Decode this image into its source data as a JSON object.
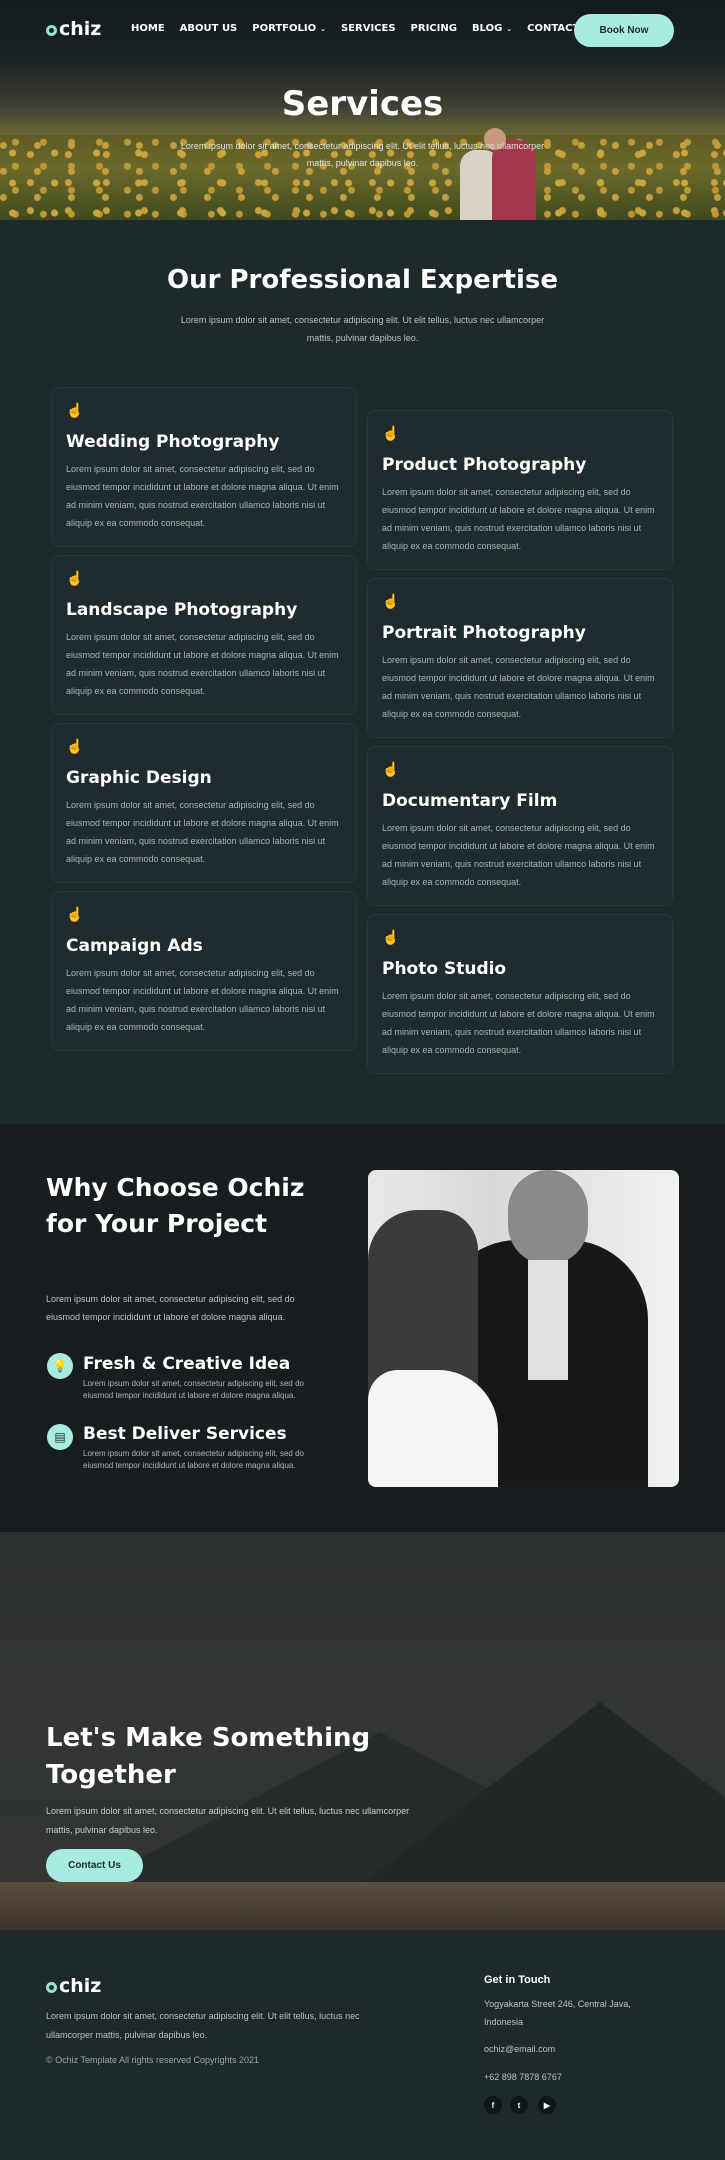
{
  "brand": {
    "name": "chiz",
    "accent": "#a8ebe0"
  },
  "nav": {
    "items": [
      {
        "label": "HOME",
        "dropdown": false
      },
      {
        "label": "ABOUT US",
        "dropdown": false
      },
      {
        "label": "PORTFOLIO",
        "dropdown": true
      },
      {
        "label": "SERVICES",
        "dropdown": false
      },
      {
        "label": "PRICING",
        "dropdown": false
      },
      {
        "label": "BLOG",
        "dropdown": true
      },
      {
        "label": "CONTACT US",
        "dropdown": false
      }
    ],
    "caret": "⌄",
    "book_label": "Book Now"
  },
  "hero": {
    "title": "Services",
    "subtitle": "Lorem ipsum dolor sit amet, consectetur adipiscing elit. Ut elit tellus, luctus nec ullamcorper mattis, pulvinar dapibus leo."
  },
  "expertise": {
    "title": "Our Professional Expertise",
    "subtitle": "Lorem ipsum dolor sit amet, consectetur adipiscing elit. Ut elit tellus, luctus nec ullamcorper mattis, pulvinar dapibus leo.",
    "icon": "☝",
    "cards": [
      {
        "title": "Wedding Photography",
        "text": "Lorem ipsum dolor sit amet, consectetur adipiscing elit, sed do eiusmod tempor incididunt ut labore et dolore magna aliqua. Ut enim ad minim veniam, quis nostrud exercitation ullamco laboris nisi ut aliquip ex ea commodo consequat."
      },
      {
        "title": "Product Photography",
        "text": "Lorem ipsum dolor sit amet, consectetur adipiscing elit, sed do eiusmod tempor incididunt ut labore et dolore magna aliqua. Ut enim ad minim veniam, quis nostrud exercitation ullamco laboris nisi ut aliquip ex ea commodo consequat."
      },
      {
        "title": "Landscape Photography",
        "text": "Lorem ipsum dolor sit amet, consectetur adipiscing elit, sed do eiusmod tempor incididunt ut labore et dolore magna aliqua. Ut enim ad minim veniam, quis nostrud exercitation ullamco laboris nisi ut aliquip ex ea commodo consequat."
      },
      {
        "title": "Portrait Photography",
        "text": "Lorem ipsum dolor sit amet, consectetur adipiscing elit, sed do eiusmod tempor incididunt ut labore et dolore magna aliqua. Ut enim ad minim veniam, quis nostrud exercitation ullamco laboris nisi ut aliquip ex ea commodo consequat."
      },
      {
        "title": "Graphic Design",
        "text": "Lorem ipsum dolor sit amet, consectetur adipiscing elit, sed do eiusmod tempor incididunt ut labore et dolore magna aliqua. Ut enim ad minim veniam, quis nostrud exercitation ullamco laboris nisi ut aliquip ex ea commodo consequat."
      },
      {
        "title": "Documentary Film",
        "text": "Lorem ipsum dolor sit amet, consectetur adipiscing elit, sed do eiusmod tempor incididunt ut labore et dolore magna aliqua. Ut enim ad minim veniam, quis nostrud exercitation ullamco laboris nisi ut aliquip ex ea commodo consequat."
      },
      {
        "title": "Campaign Ads",
        "text": "Lorem ipsum dolor sit amet, consectetur adipiscing elit, sed do eiusmod tempor incididunt ut labore et dolore magna aliqua. Ut enim ad minim veniam, quis nostrud exercitation ullamco laboris nisi ut aliquip ex ea commodo consequat."
      },
      {
        "title": "Photo Studio",
        "text": "Lorem ipsum dolor sit amet, consectetur adipiscing elit, sed do eiusmod tempor incididunt ut labore et dolore magna aliqua. Ut enim ad minim veniam, quis nostrud exercitation ullamco laboris nisi ut aliquip ex ea commodo consequat."
      }
    ]
  },
  "why": {
    "title": "Why Choose Ochiz for Your Project",
    "subtitle": "Lorem ipsum dolor sit amet, consectetur adipiscing elit, sed do eiusmod tempor incididunt ut labore et dolore magna aliqua.",
    "features": [
      {
        "icon": "💡",
        "icon_name": "lightbulb-icon",
        "title": "Fresh & Creative Idea",
        "text": "Lorem ipsum dolor sit amet, consectetur adipiscing elit, sed do eiusmod tempor incididunt ut labore et dolore magna aliqua."
      },
      {
        "icon": "▤",
        "icon_name": "card-icon",
        "title": "Best Deliver Services",
        "text": "Lorem ipsum dolor sit amet, consectetur adipiscing elit, sed do eiusmod tempor incididunt ut labore et dolore magna aliqua."
      }
    ]
  },
  "cta": {
    "title": "Let's Make Something Together",
    "subtitle": "Lorem ipsum dolor sit amet, consectetur adipiscing elit. Ut elit tellus, luctus nec ullamcorper mattis, pulvinar dapibus leo.",
    "button_label": "Contact Us"
  },
  "footer": {
    "description": "Lorem ipsum dolor sit amet, consectetur adipiscing elit. Ut elit tellus, luctus nec ullamcorper mattis, pulvinar dapibus leo.",
    "copyright": "© Ochiz Template All rights reserved Copyrights 2021",
    "contact_heading": "Get in Touch",
    "address": "Yogyakarta Street 246, Central Java, Indonesia",
    "email": "ochiz@email.com",
    "phone": "+62 898 7878 6767",
    "social": [
      {
        "glyph": "f",
        "icon_name": "facebook-icon"
      },
      {
        "glyph": "t",
        "icon_name": "twitter-icon"
      },
      {
        "glyph": "▶",
        "icon_name": "youtube-icon"
      }
    ]
  }
}
